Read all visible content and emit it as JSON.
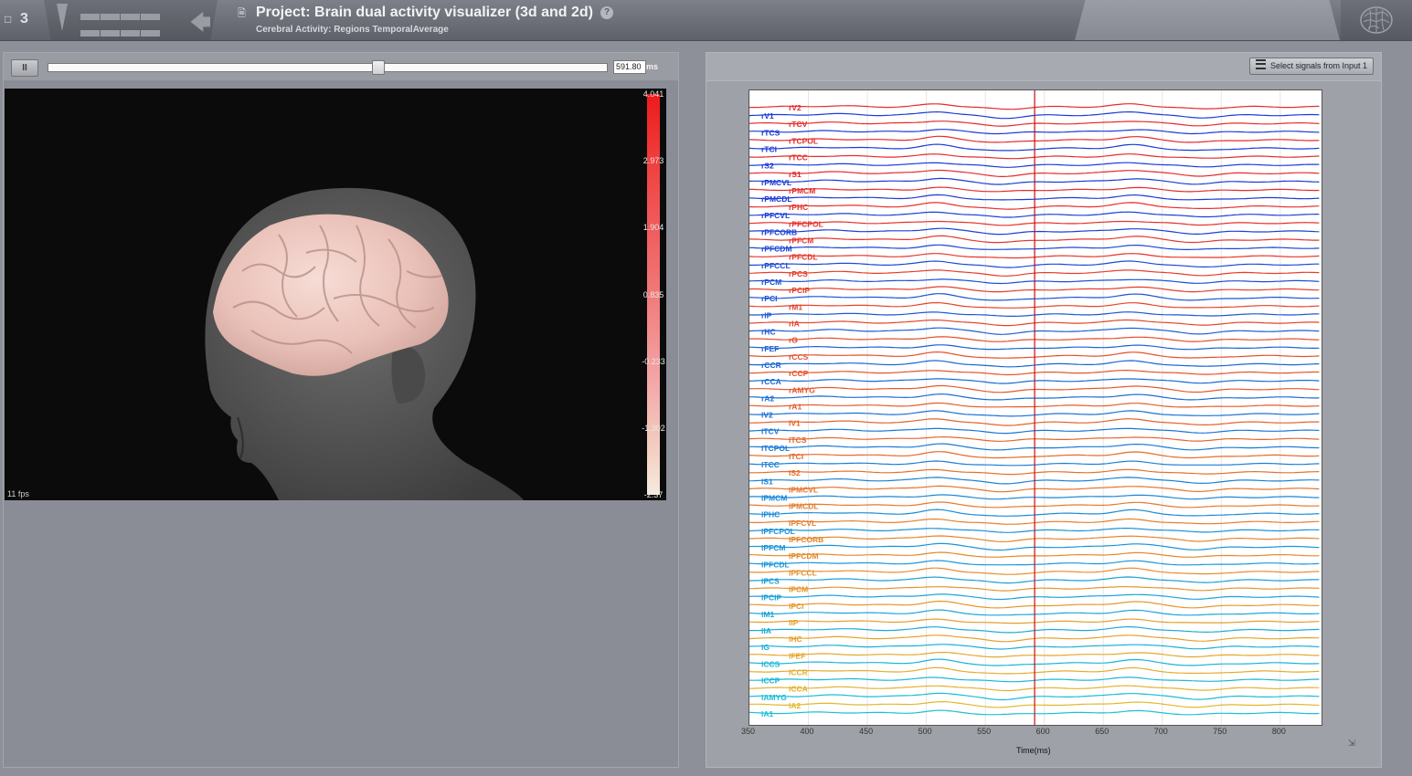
{
  "header": {
    "project_count": "3",
    "title": "Project: Brain dual activity visualizer (3d and 2d)",
    "help": "?",
    "subtitle": "Cerebral Activity: Regions TemporalAverage"
  },
  "left_panel": {
    "pause_label": "II",
    "slider_fraction": 0.59,
    "time_value": "591.80",
    "time_unit": "ms",
    "fps": "11 fps",
    "colorbar_labels": [
      "4.041",
      "2.973",
      "1.904",
      "0.835",
      "-0.233",
      "-1.302",
      "-2.37"
    ]
  },
  "right_panel": {
    "select_button": "Select signals from Input 1",
    "chart_data": {
      "type": "line",
      "xlabel": "Time(ms)",
      "xlim": [
        350,
        835
      ],
      "xticks": [
        350,
        400,
        450,
        500,
        550,
        600,
        650,
        700,
        750,
        800
      ],
      "cursor_x": 591.8,
      "channels": [
        {
          "name": "rV2",
          "color": "#e52b2b"
        },
        {
          "name": "rV1",
          "color": "#1a3bd6"
        },
        {
          "name": "rTCV",
          "color": "#e52b2b"
        },
        {
          "name": "rTCS",
          "color": "#1a3bd6"
        },
        {
          "name": "rTCPOL",
          "color": "#e52b2b"
        },
        {
          "name": "rTCI",
          "color": "#1a3bd6"
        },
        {
          "name": "rTCC",
          "color": "#e52b2b"
        },
        {
          "name": "rS2",
          "color": "#1a3bd6"
        },
        {
          "name": "rS1",
          "color": "#e52b2b"
        },
        {
          "name": "rPMCVL",
          "color": "#1a3bd6"
        },
        {
          "name": "rPMCM",
          "color": "#e52b2b"
        },
        {
          "name": "rPMCDL",
          "color": "#1a3bd6"
        },
        {
          "name": "rPHC",
          "color": "#e5302b"
        },
        {
          "name": "rPFCVL",
          "color": "#1a40d6"
        },
        {
          "name": "rPFCPOL",
          "color": "#e5302b"
        },
        {
          "name": "rPFCORB",
          "color": "#1a40d6"
        },
        {
          "name": "rPFCM",
          "color": "#e5362b"
        },
        {
          "name": "rPFCDM",
          "color": "#1a46d6"
        },
        {
          "name": "rPFCDL",
          "color": "#e5362b"
        },
        {
          "name": "rPFCCL",
          "color": "#1a4bd6"
        },
        {
          "name": "rPCS",
          "color": "#e53d2b"
        },
        {
          "name": "rPCM",
          "color": "#1a4fd6"
        },
        {
          "name": "rPCIP",
          "color": "#e53d2b"
        },
        {
          "name": "rPCI",
          "color": "#1a54d6"
        },
        {
          "name": "rM1",
          "color": "#e5442b"
        },
        {
          "name": "rIP",
          "color": "#1a58d6"
        },
        {
          "name": "rIA",
          "color": "#e5442b"
        },
        {
          "name": "rHC",
          "color": "#1a5cd6"
        },
        {
          "name": "rG",
          "color": "#e54b2b"
        },
        {
          "name": "rFEF",
          "color": "#1a60d6"
        },
        {
          "name": "rCCS",
          "color": "#e54f2b"
        },
        {
          "name": "rCCR",
          "color": "#1a64d6"
        },
        {
          "name": "rCCP",
          "color": "#e5532b"
        },
        {
          "name": "rCCA",
          "color": "#1a68d6"
        },
        {
          "name": "rAMYG",
          "color": "#e5582b"
        },
        {
          "name": "rA2",
          "color": "#1a6dd6"
        },
        {
          "name": "rA1",
          "color": "#e55c2b"
        },
        {
          "name": "lV2",
          "color": "#1a71d6"
        },
        {
          "name": "lV1",
          "color": "#e5612b"
        },
        {
          "name": "lTCV",
          "color": "#1a75d6"
        },
        {
          "name": "lTCS",
          "color": "#e5662b"
        },
        {
          "name": "lTCPOL",
          "color": "#1a7ad6"
        },
        {
          "name": "lTCI",
          "color": "#e56b2b"
        },
        {
          "name": "lTCC",
          "color": "#1a7ed6"
        },
        {
          "name": "lS2",
          "color": "#e5702b"
        },
        {
          "name": "lS1",
          "color": "#1a82d6"
        },
        {
          "name": "lPMCVL",
          "color": "#e5752b"
        },
        {
          "name": "lPMCM",
          "color": "#1a87d6"
        },
        {
          "name": "lPMCDL",
          "color": "#e57a2b"
        },
        {
          "name": "lPHC",
          "color": "#1a8bd6"
        },
        {
          "name": "lPFCVL",
          "color": "#e57f2b"
        },
        {
          "name": "lPFCPOL",
          "color": "#1a90d6"
        },
        {
          "name": "lPFCORB",
          "color": "#e5842b"
        },
        {
          "name": "lPFCM",
          "color": "#1a94d6"
        },
        {
          "name": "lPFCDM",
          "color": "#e5892b"
        },
        {
          "name": "lPFCDL",
          "color": "#1a99d6"
        },
        {
          "name": "lPFCCL",
          "color": "#e58e2b"
        },
        {
          "name": "lPCS",
          "color": "#1a9dd6"
        },
        {
          "name": "lPCM",
          "color": "#e5932b"
        },
        {
          "name": "lPCIP",
          "color": "#1aa2d6"
        },
        {
          "name": "lPCI",
          "color": "#e5982b"
        },
        {
          "name": "lM1",
          "color": "#1aa6d6"
        },
        {
          "name": "lIP",
          "color": "#e59d2b"
        },
        {
          "name": "lIA",
          "color": "#1aabd6"
        },
        {
          "name": "lHC",
          "color": "#e5a22b"
        },
        {
          "name": "lG",
          "color": "#1aafd6"
        },
        {
          "name": "lFEF",
          "color": "#e5a72b"
        },
        {
          "name": "lCCS",
          "color": "#1ab4d6"
        },
        {
          "name": "lCCR",
          "color": "#e5ac2b"
        },
        {
          "name": "lCCP",
          "color": "#1ab8d6"
        },
        {
          "name": "lCCA",
          "color": "#e5b12b"
        },
        {
          "name": "lAMYG",
          "color": "#1abdd6"
        },
        {
          "name": "lA2",
          "color": "#e5b62b"
        },
        {
          "name": "lA1",
          "color": "#1ac1d6"
        }
      ]
    }
  }
}
